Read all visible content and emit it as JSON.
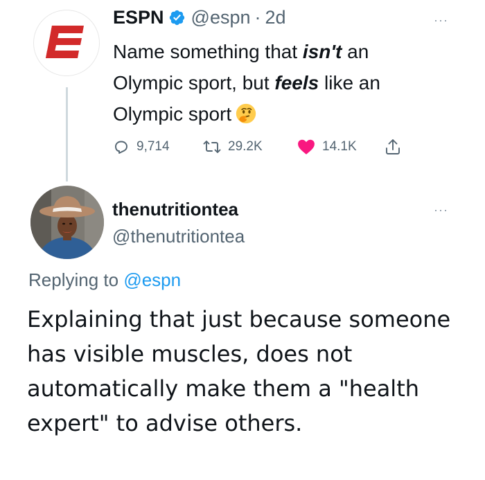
{
  "original_tweet": {
    "display_name": "ESPN",
    "handle": "@espn",
    "separator": "·",
    "time": "2d",
    "text_parts": [
      "Name something that ",
      "isn't",
      " an Olympic sport, but ",
      "feels",
      " like an Olympic sport"
    ],
    "emoji": "thinking-face",
    "stats": {
      "replies": "9,714",
      "retweets": "29.2K",
      "likes": "14.1K"
    },
    "more": "···"
  },
  "reply_tweet": {
    "display_name": "thenutritiontea",
    "handle": "@thenutritiontea",
    "replying_to_label": "Replying to",
    "replying_to_handle": "@espn",
    "text": "Explaining that just because someone has visible muscles, does not automatically make them a \"health expert\" to advise others.",
    "more": "···"
  },
  "icons": {
    "espn_logo": "espn-logo",
    "verified": "verified-badge-icon",
    "reply": "reply-icon",
    "retweet": "retweet-icon",
    "like": "heart-icon",
    "share": "share-icon"
  },
  "colors": {
    "espn_red": "#d22a2a",
    "verified_blue": "#1d9bf0",
    "like_red": "#f91880",
    "secondary_text": "#536471",
    "link_blue": "#1d9bf0"
  }
}
